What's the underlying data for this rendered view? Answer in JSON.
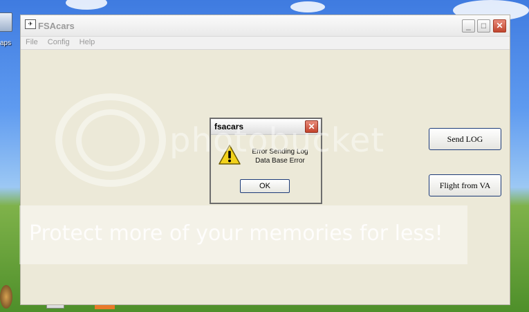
{
  "desktop": {
    "icon_label": "aps"
  },
  "window": {
    "title": "FSAcars",
    "menu": [
      "File",
      "Config",
      "Help"
    ],
    "buttons": {
      "send_log": "Send LOG",
      "flight_from_va": "Flight from VA"
    }
  },
  "dialog": {
    "title": "fsacars",
    "message_line1": "Error Sending Log",
    "message_line2": "Data Base Error",
    "ok_label": "OK",
    "icon": "warning-icon"
  },
  "watermark": {
    "brand": "photobucket",
    "banner": "Protect more of your memories for less!"
  },
  "colors": {
    "dialog_close": "#c3432c",
    "window_bg": "#ECE9D8",
    "button_border": "#1c3a78"
  }
}
